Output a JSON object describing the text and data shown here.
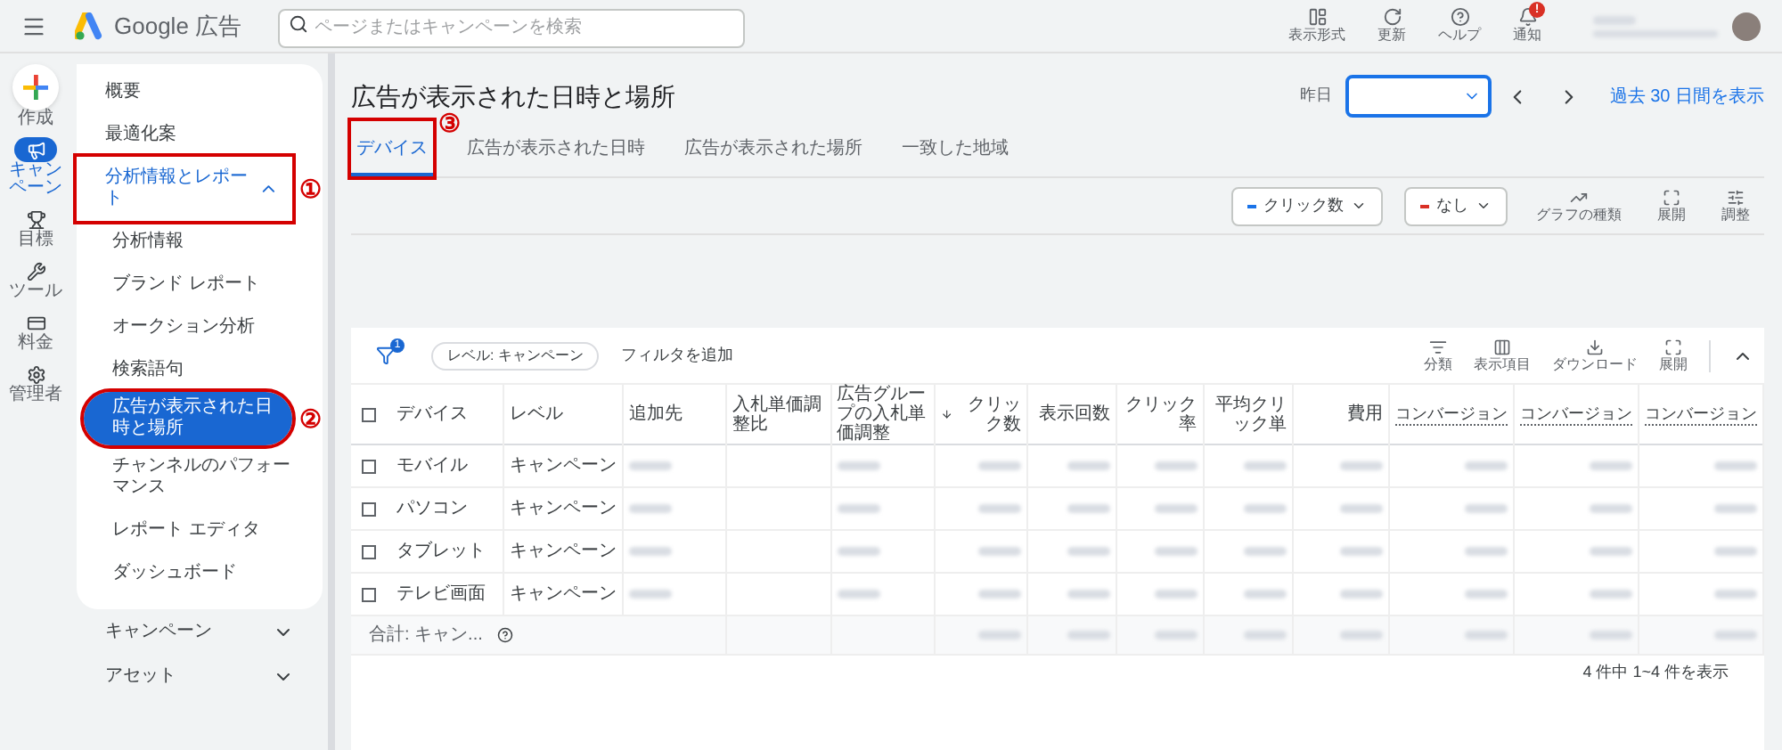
{
  "app": {
    "name": "Google 広告"
  },
  "search": {
    "placeholder": "ページまたはキャンペーンを検索"
  },
  "top_actions": [
    {
      "label": "表示形式"
    },
    {
      "label": "更新"
    },
    {
      "label": "ヘルプ"
    },
    {
      "label": "通知",
      "badge": "!"
    }
  ],
  "rail": [
    {
      "label": "作成",
      "selected": false
    },
    {
      "label": "キャンペーン",
      "selected": true
    },
    {
      "label": "目標",
      "selected": false
    },
    {
      "label": "ツール",
      "selected": false
    },
    {
      "label": "料金",
      "selected": false
    },
    {
      "label": "管理者",
      "selected": false
    }
  ],
  "nav": {
    "items": [
      {
        "label": "概要",
        "selected": false
      },
      {
        "label": "最適化案",
        "selected": false
      },
      {
        "label": "分析情報とレポート",
        "selected": false,
        "expanded": true,
        "marker": "①",
        "children": [
          {
            "label": "分析情報",
            "selected": false
          },
          {
            "label": "ブランド レポート",
            "selected": false
          },
          {
            "label": "オークション分析",
            "selected": false
          },
          {
            "label": "検索語句",
            "selected": false
          },
          {
            "label": "広告が表示された日時と場所",
            "selected": true,
            "marker": "②"
          },
          {
            "label": "チャンネルのパフォーマンス",
            "selected": false
          },
          {
            "label": "レポート エディタ",
            "selected": false
          },
          {
            "label": "ダッシュボード",
            "selected": false
          }
        ]
      }
    ],
    "sections": [
      {
        "label": "キャンペーン",
        "expanded": false
      },
      {
        "label": "アセット",
        "expanded": false
      }
    ]
  },
  "page": {
    "title": "広告が表示された日時と場所",
    "date_label": "昨日",
    "date_link": "過去 30 日間を表示"
  },
  "tabs": [
    {
      "label": "デバイス",
      "selected": true,
      "marker": "③"
    },
    {
      "label": "広告が表示された日時",
      "selected": false
    },
    {
      "label": "広告が表示された場所",
      "selected": false
    },
    {
      "label": "一致した地域",
      "selected": false
    }
  ],
  "chart_toolbar": {
    "metrics": [
      {
        "label": "クリック数",
        "color": "#1a73e8"
      },
      {
        "label": "なし",
        "color": "#d93025"
      }
    ],
    "actions": [
      {
        "label": "グラフの種類"
      },
      {
        "label": "展開"
      },
      {
        "label": "調整"
      }
    ]
  },
  "table_toolbar": {
    "filter_count": "1",
    "chip": "レベル: キャンペーン",
    "add_filter": "フィルタを追加",
    "actions": [
      {
        "label": "分類"
      },
      {
        "label": "表示項目"
      },
      {
        "label": "ダウンロード"
      },
      {
        "label": "展開"
      }
    ]
  },
  "table": {
    "columns": [
      {
        "label": "デバイス",
        "kind": "text"
      },
      {
        "label": "レベル",
        "kind": "text"
      },
      {
        "label": "追加先",
        "kind": "redacted"
      },
      {
        "label": "入札単価調整比",
        "kind": "blank"
      },
      {
        "label": "広告グループの入札単価調整",
        "kind": "redacted"
      },
      {
        "label": "クリック数",
        "kind": "redacted",
        "sorted": true
      },
      {
        "label": "表示回数",
        "kind": "redacted"
      },
      {
        "label": "クリック率",
        "kind": "redacted"
      },
      {
        "label": "平均クリック単",
        "kind": "redacted"
      },
      {
        "label": "費用",
        "kind": "redacted"
      },
      {
        "label": "コンバージョン",
        "kind": "redacted",
        "dotted": true
      },
      {
        "label": "コンバージョン",
        "kind": "redacted",
        "dotted": true
      },
      {
        "label": "コンバージョン",
        "kind": "redacted",
        "dotted": true
      }
    ],
    "rows": [
      {
        "cells": [
          "モバイル",
          "キャンペーン"
        ],
        "checked": false
      },
      {
        "cells": [
          "パソコン",
          "キャンペーン"
        ],
        "checked": false
      },
      {
        "cells": [
          "タブレット",
          "キャンペーン"
        ],
        "checked": false
      },
      {
        "cells": [
          "テレビ画面",
          "キャンペーン"
        ],
        "checked": false
      }
    ],
    "all_checked": false,
    "total": "合計: キャン..."
  },
  "footer": "4 件中 1~4 件を表示"
}
